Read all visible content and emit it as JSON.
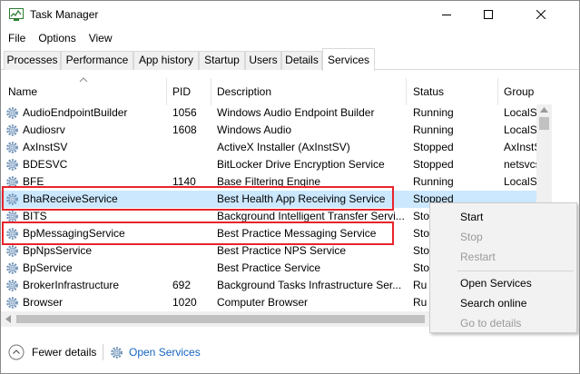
{
  "window": {
    "title": "Task Manager"
  },
  "menu": [
    "File",
    "Options",
    "View"
  ],
  "tabs": [
    {
      "label": "Processes",
      "active": false
    },
    {
      "label": "Performance",
      "active": false
    },
    {
      "label": "App history",
      "active": false
    },
    {
      "label": "Startup",
      "active": false
    },
    {
      "label": "Users",
      "active": false
    },
    {
      "label": "Details",
      "active": false
    },
    {
      "label": "Services",
      "active": true
    }
  ],
  "columns": {
    "name": "Name",
    "pid": "PID",
    "description": "Description",
    "status": "Status",
    "group": "Group"
  },
  "rows": [
    {
      "name": "AudioEndpointBuilder",
      "pid": "1056",
      "description": "Windows Audio Endpoint Builder",
      "status": "Running",
      "group": "LocalS"
    },
    {
      "name": "Audiosrv",
      "pid": "1608",
      "description": "Windows Audio",
      "status": "Running",
      "group": "LocalS"
    },
    {
      "name": "AxInstSV",
      "pid": "",
      "description": "ActiveX Installer (AxInstSV)",
      "status": "Stopped",
      "group": "AxInstS"
    },
    {
      "name": "BDESVC",
      "pid": "",
      "description": "BitLocker Drive Encryption Service",
      "status": "Stopped",
      "group": "netsvcs"
    },
    {
      "name": "BFE",
      "pid": "1140",
      "description": "Base Filtering Engine",
      "status": "Running",
      "group": "LocalS"
    },
    {
      "name": "BhaReceiveService",
      "pid": "",
      "description": "Best Health App Receiving Service",
      "status": "Stopped",
      "group": ""
    },
    {
      "name": "BITS",
      "pid": "",
      "description": "Background Intelligent Transfer Servi...",
      "status": "Sto",
      "group": ""
    },
    {
      "name": "BpMessagingService",
      "pid": "",
      "description": "Best Practice Messaging Service",
      "status": "Sto",
      "group": ""
    },
    {
      "name": "BpNpsService",
      "pid": "",
      "description": "Best Practice NPS Service",
      "status": "Sto",
      "group": ""
    },
    {
      "name": "BpService",
      "pid": "",
      "description": "Best Practice Service",
      "status": "Sto",
      "group": ""
    },
    {
      "name": "BrokerInfrastructure",
      "pid": "692",
      "description": "Background Tasks Infrastructure Ser...",
      "status": "Ru",
      "group": ""
    },
    {
      "name": "Browser",
      "pid": "1020",
      "description": "Computer Browser",
      "status": "Ru",
      "group": ""
    }
  ],
  "selected_row": "BhaReceiveService",
  "context_menu": {
    "start": "Start",
    "stop": "Stop",
    "restart": "Restart",
    "open_services": "Open Services",
    "search_online": "Search online",
    "go_to_details": "Go to details"
  },
  "footer": {
    "fewer_details": "Fewer details",
    "open_services": "Open Services"
  },
  "colors": {
    "selection": "#cce8ff",
    "highlight_box": "#e8242c",
    "link": "#1565c0",
    "disabled_text": "#9a9a9a"
  }
}
